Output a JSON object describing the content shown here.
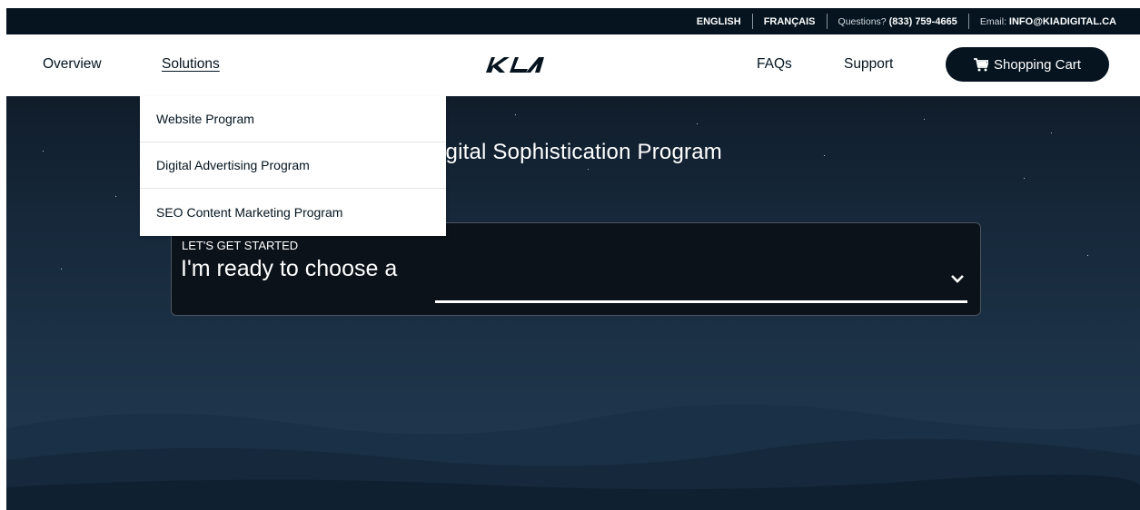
{
  "topbar": {
    "english": "ENGLISH",
    "francais": "FRANÇAIS",
    "questions_label": "Questions?",
    "phone": "(833) 759-4665",
    "email_label": "Email:",
    "email": "INFO@KIADIGITAL.CA"
  },
  "nav": {
    "overview": "Overview",
    "solutions": "Solutions",
    "logo_icon": "kia-logo-icon",
    "faqs": "FAQs",
    "support": "Support",
    "cart_label": "Shopping Cart",
    "cart_icon": "cart-icon"
  },
  "dropdown": {
    "items": [
      "Website Program",
      "Digital Advertising Program",
      "SEO Content Marketing Program"
    ]
  },
  "hero": {
    "title": "igital Sophistication Program",
    "eyebrow": "LET'S GET STARTED",
    "ready_text": "I'm ready to choose a",
    "select_icon": "chevron-down-icon"
  },
  "colors": {
    "brand_dark": "#05141f",
    "white": "#ffffff"
  }
}
